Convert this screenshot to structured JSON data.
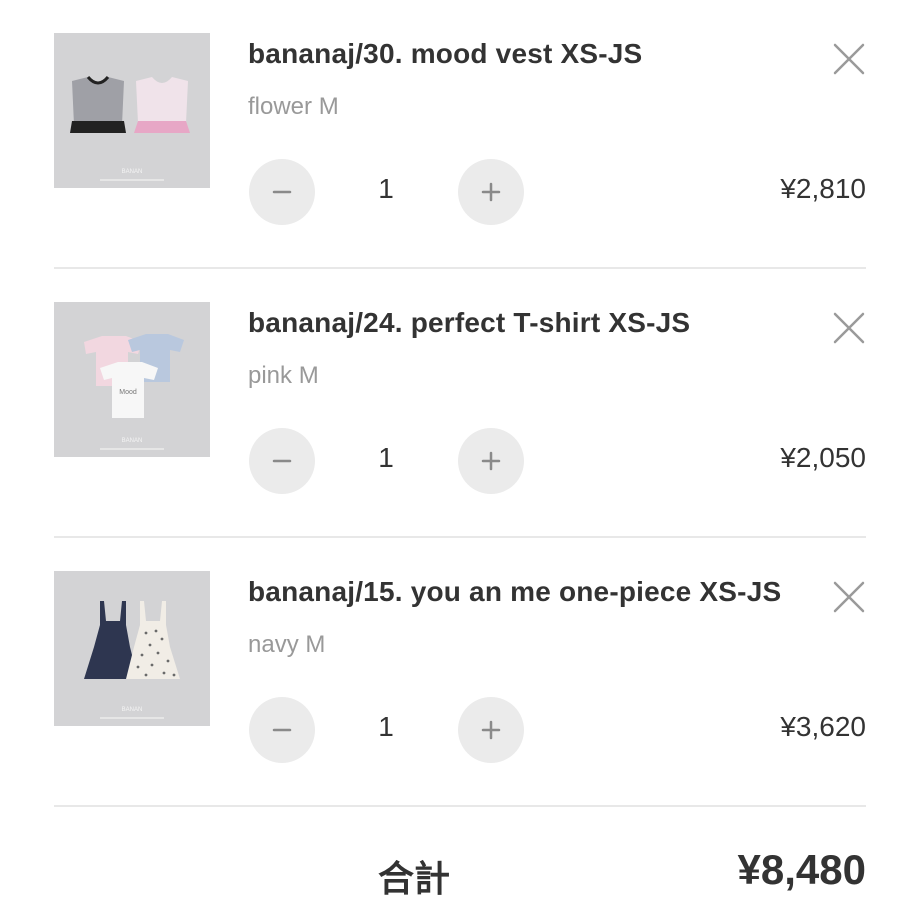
{
  "cart": {
    "items": [
      {
        "title": "bananaj/30. mood vest XS-JS",
        "variant": "flower M",
        "quantity": "1",
        "price": "¥2,810",
        "thumbnail_icon": "vest-product-photo",
        "remove_icon": "close-icon",
        "minus_icon": "minus-icon",
        "plus_icon": "plus-icon"
      },
      {
        "title": "bananaj/24. perfect T-shirt XS-JS",
        "variant": "pink M",
        "quantity": "1",
        "price": "¥2,050",
        "thumbnail_icon": "tshirt-product-photo",
        "remove_icon": "close-icon",
        "minus_icon": "minus-icon",
        "plus_icon": "plus-icon"
      },
      {
        "title": "bananaj/15. you an me one-piece XS-JS",
        "variant": "navy M",
        "quantity": "1",
        "price": "¥3,620",
        "thumbnail_icon": "onepiece-product-photo",
        "remove_icon": "close-icon",
        "minus_icon": "minus-icon",
        "plus_icon": "plus-icon"
      }
    ],
    "total_label": "合計",
    "total_value": "¥8,480"
  },
  "colors": {
    "text": "#333333",
    "muted": "#999999",
    "button_bg": "#ebebeb",
    "divider": "#e8e8e8",
    "thumb_bg": "#d3d3d5"
  }
}
